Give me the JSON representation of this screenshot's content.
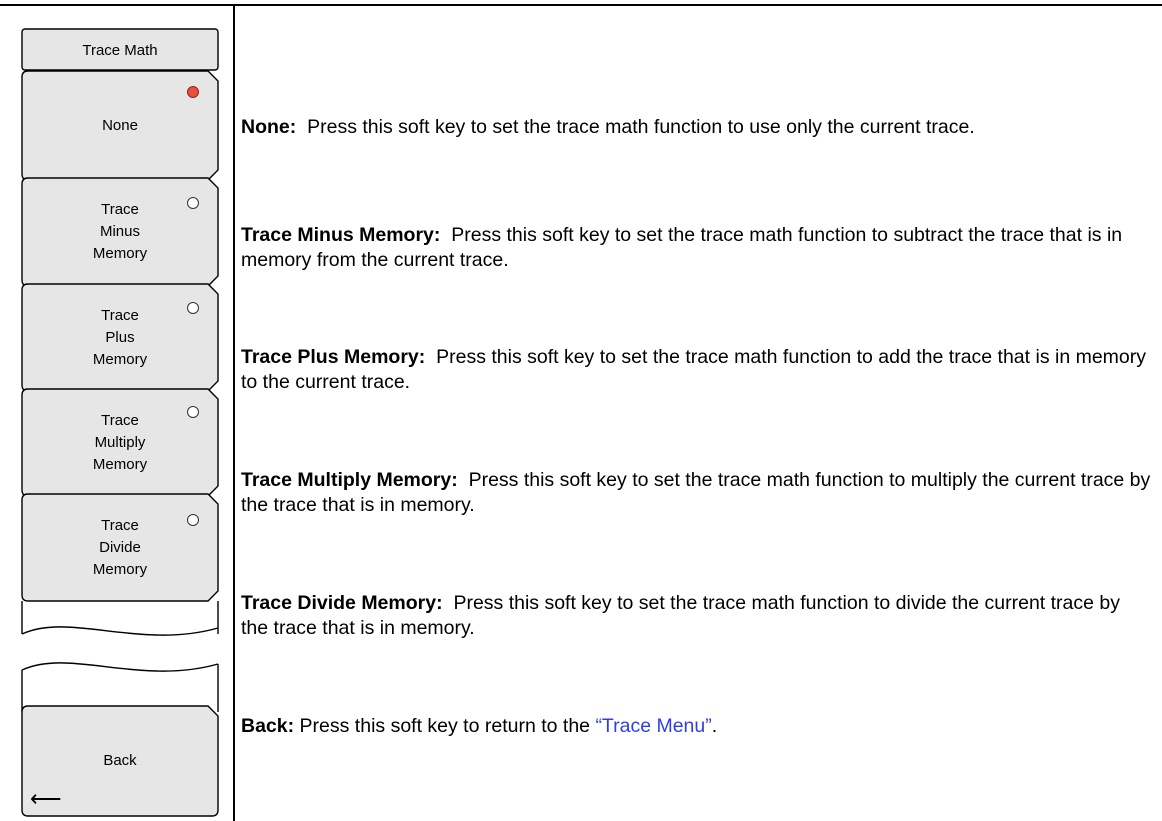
{
  "menu": {
    "title": "Trace Math",
    "keys": [
      {
        "label": "None",
        "selected": true
      },
      {
        "label": "Trace\nMinus\nMemory",
        "selected": false
      },
      {
        "label": "Trace\nPlus\nMemory",
        "selected": false
      },
      {
        "label": "Trace\nMultiply\nMemory",
        "selected": false
      },
      {
        "label": "Trace\nDivide\nMemory",
        "selected": false
      }
    ],
    "back_label": "Back",
    "back_icon": "left-arrow-icon"
  },
  "descriptions": [
    {
      "term": "None:",
      "text": "Press this soft key to set the trace math function to use only the current trace."
    },
    {
      "term": "Trace Minus Memory:",
      "text": "Press this soft key to set the trace math function to subtract the trace that is in memory from the current trace."
    },
    {
      "term": "Trace Plus Memory:",
      "text": "Press this soft key to set the trace math function to add the trace that is in memory to the current trace."
    },
    {
      "term": "Trace Multiply Memory:",
      "text": "Press this soft key to set the trace math function to multiply the current trace by the trace that is in memory."
    },
    {
      "term": "Trace Divide Memory:",
      "text": "Press this soft key to set the trace math function to divide the current trace by the trace that is in memory."
    },
    {
      "term": "Back:",
      "text": "Press this soft key to return to the ",
      "link": "“Trace Menu”",
      "after": "."
    }
  ],
  "colors": {
    "selected_radio": "#e8503a",
    "link": "#2f3ee8"
  }
}
